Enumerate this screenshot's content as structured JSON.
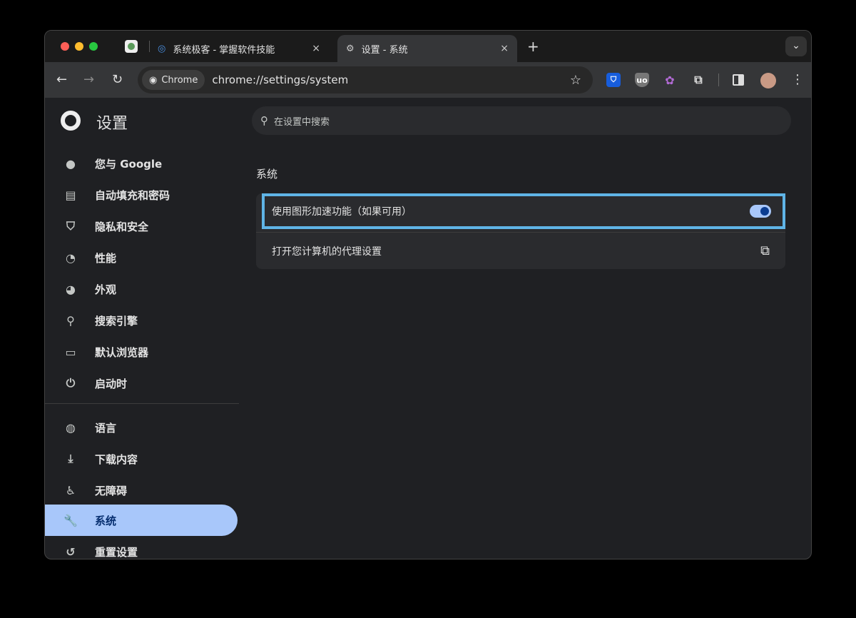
{
  "window": {
    "tabs": [
      {
        "label": "系统极客 - 掌握软件技能",
        "close": "×"
      },
      {
        "label": "设置 - 系统",
        "close": "×"
      }
    ],
    "new_tab": "+",
    "tab_search": "⌄"
  },
  "toolbar": {
    "chip": "Chrome",
    "url": "chrome://settings/system",
    "back": "←",
    "forward": "→",
    "reload": "↻",
    "star": "☆",
    "menu": "⋮"
  },
  "extensions": [
    "bitwarden",
    "ublock-origin",
    "openai",
    "extensions-puzzle",
    "side-panel",
    "profile-avatar"
  ],
  "settings": {
    "title": "设置",
    "search_placeholder": "在设置中搜索",
    "sidebar": [
      {
        "label": "您与 Google",
        "icon": "person"
      },
      {
        "label": "自动填充和密码",
        "icon": "clipboard"
      },
      {
        "label": "隐私和安全",
        "icon": "shield"
      },
      {
        "label": "性能",
        "icon": "gauge"
      },
      {
        "label": "外观",
        "icon": "palette"
      },
      {
        "label": "搜索引擎",
        "icon": "search"
      },
      {
        "label": "默认浏览器",
        "icon": "browser"
      },
      {
        "label": "启动时",
        "icon": "power"
      },
      {
        "label": "语言",
        "icon": "globe"
      },
      {
        "label": "下载内容",
        "icon": "download"
      },
      {
        "label": "无障碍",
        "icon": "accessibility"
      },
      {
        "label": "系统",
        "icon": "wrench",
        "selected": true
      },
      {
        "label": "重置设置",
        "icon": "history"
      }
    ],
    "section_title": "系统",
    "rows": [
      {
        "label": "使用图形加速功能（如果可用）",
        "toggle_on": true
      },
      {
        "label": "打开您计算机的代理设置",
        "icon": "open-external"
      }
    ]
  },
  "colors": {
    "accent": "#a8c7fa",
    "highlight_border": "#5fb4e6"
  }
}
